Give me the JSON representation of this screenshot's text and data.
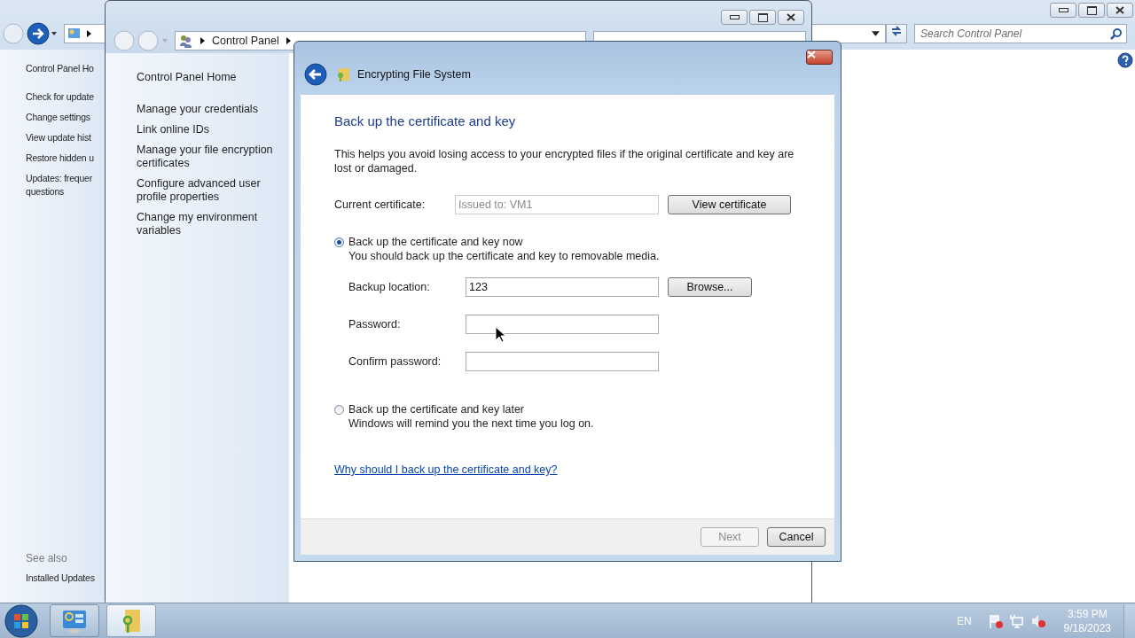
{
  "back_window": {
    "search": {
      "placeholder": "Search Control Panel"
    },
    "sidebar": {
      "home": "Control Panel Ho",
      "items": [
        [
          "Check for update"
        ],
        [
          "Change settings"
        ],
        [
          "View update hist"
        ],
        [
          "Restore hidden u"
        ],
        [
          "Updates: frequer",
          "questions"
        ]
      ]
    },
    "see_also": {
      "title": "See also",
      "items": [
        "Installed Updates"
      ]
    }
  },
  "middle_window": {
    "address": {
      "crumbs": [
        "Control Panel"
      ]
    },
    "sidebar": {
      "home": "Control Panel Home",
      "items": [
        "Manage your credentials",
        "Link online IDs",
        "Manage your file encryption certificates",
        "Configure advanced user profile properties",
        "Change my environment variables"
      ]
    }
  },
  "dialog": {
    "title": "Encrypting File System",
    "heading": "Back up the certificate and key",
    "intro": "This helps you avoid losing access to your encrypted files if the original certificate and key are lost or damaged.",
    "current_certificate": {
      "label": "Current certificate:",
      "value": "Issued to: VM1",
      "disabled": true,
      "button": "View certificate"
    },
    "options": [
      {
        "label": "Back up the certificate and key now",
        "description": "You should back up the certificate and key to removable media.",
        "selected": true,
        "fields": [
          {
            "label": "Backup location:",
            "value": "123",
            "button": "Browse..."
          },
          {
            "label": "Password:"
          },
          {
            "label": "Confirm password:"
          }
        ]
      },
      {
        "label": "Back up the certificate and key later",
        "description": "Windows will remind you the next time you log on.",
        "selected": false
      }
    ],
    "link": "Why should I back up the certificate and key?",
    "buttons": [
      {
        "label": "Next",
        "disabled": true
      },
      {
        "label": "Cancel",
        "disabled": false
      }
    ]
  },
  "taskbar": {
    "tasks": [
      {
        "kind": "control-panel",
        "selected": false
      },
      {
        "kind": "key-folder",
        "selected": true
      }
    ],
    "language": "EN",
    "time": "3:59 PM",
    "date": "9/18/2023"
  }
}
